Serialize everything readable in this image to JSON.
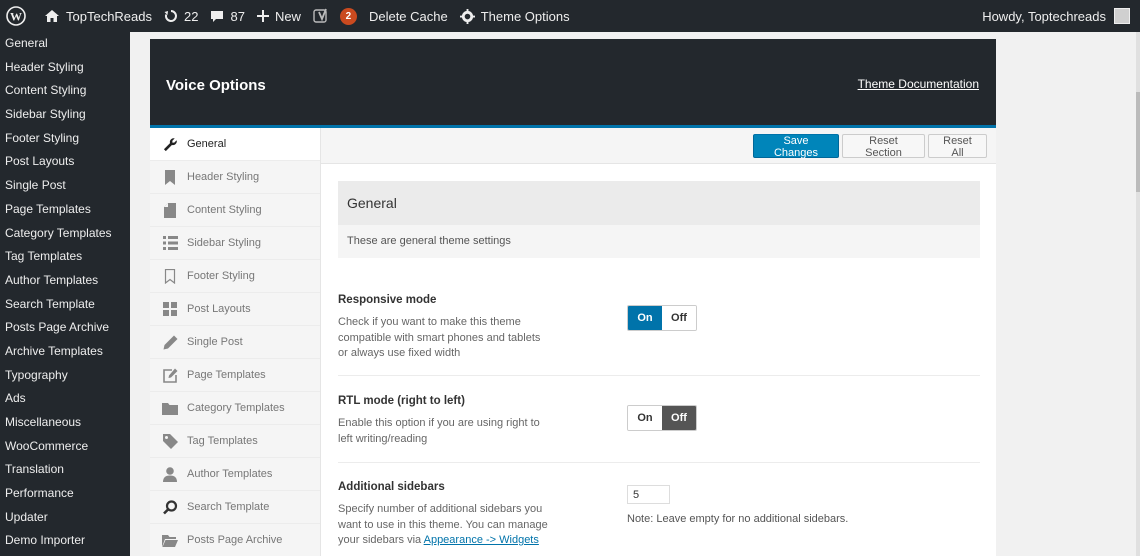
{
  "adminbar": {
    "site_name": "TopTechReads",
    "updates_count": "22",
    "comments_count": "87",
    "new_label": "New",
    "seo_badge": "2",
    "delete_cache_label": "Delete Cache",
    "theme_options_label": "Theme Options",
    "howdy_label": "Howdy, Toptechreads"
  },
  "admin_menu": {
    "items": [
      "General",
      "Header Styling",
      "Content Styling",
      "Sidebar Styling",
      "Footer Styling",
      "Post Layouts",
      "Single Post",
      "Page Templates",
      "Category Templates",
      "Tag Templates",
      "Author Templates",
      "Search Template",
      "Posts Page Archive",
      "Archive Templates",
      "Typography",
      "Ads",
      "Miscellaneous",
      "WooCommerce",
      "Translation",
      "Performance",
      "Updater",
      "Demo Importer"
    ]
  },
  "panel": {
    "title": "Voice Options",
    "doc_link": "Theme Documentation",
    "tabs": [
      {
        "label": "General",
        "icon": "wrench-icon"
      },
      {
        "label": "Header Styling",
        "icon": "bookmark-icon"
      },
      {
        "label": "Content Styling",
        "icon": "document-icon"
      },
      {
        "label": "Sidebar Styling",
        "icon": "list-icon"
      },
      {
        "label": "Footer Styling",
        "icon": "bookmark-outline-icon"
      },
      {
        "label": "Post Layouts",
        "icon": "grid-icon"
      },
      {
        "label": "Single Post",
        "icon": "pencil-icon"
      },
      {
        "label": "Page Templates",
        "icon": "edit-icon"
      },
      {
        "label": "Category Templates",
        "icon": "folder-icon"
      },
      {
        "label": "Tag Templates",
        "icon": "tag-icon"
      },
      {
        "label": "Author Templates",
        "icon": "user-icon"
      },
      {
        "label": "Search Template",
        "icon": "search-icon"
      },
      {
        "label": "Posts Page Archive",
        "icon": "folder-open-icon"
      }
    ],
    "toolbar": {
      "save_label": "Save Changes",
      "reset_section_label": "Reset Section",
      "reset_all_label": "Reset All"
    },
    "section": {
      "title": "General",
      "description": "These are general theme settings"
    },
    "fields": {
      "responsive": {
        "title": "Responsive mode",
        "desc_l1": "Check if you want to make this theme",
        "desc_l2": "compatible with smart phones and tablets",
        "desc_l3": "or always use fixed width",
        "on_label": "On",
        "off_label": "Off"
      },
      "rtl": {
        "title": "RTL mode (right to left)",
        "desc_l1": "Enable this option if you are using right to",
        "desc_l2": "left writing/reading",
        "on_label": "On",
        "off_label": "Off"
      },
      "sidebars": {
        "title": "Additional sidebars",
        "desc_l1": "Specify number of additional sidebars you",
        "desc_l2": "want to use in this theme. You can manage",
        "desc_l3_prefix": "your sidebars via",
        "desc_link": "Appearance -> Widgets",
        "value": "5",
        "note": "Note: Leave empty for no additional sidebars."
      }
    }
  },
  "colors": {
    "adminbar_bg": "#23282d",
    "accent_blue": "#0073aa",
    "badge_orange": "#ca4a1f"
  }
}
